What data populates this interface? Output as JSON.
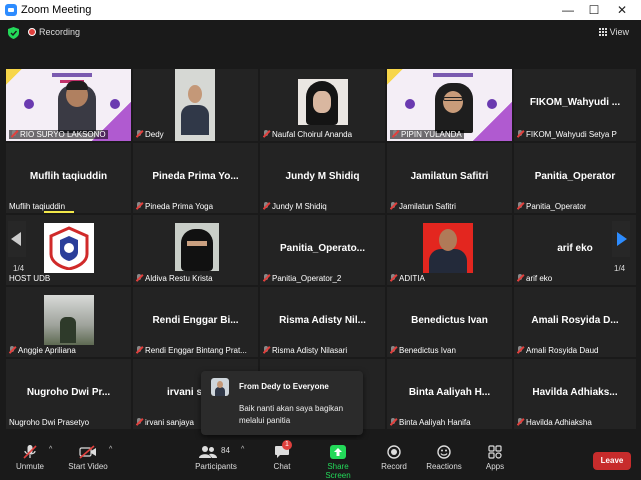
{
  "window": {
    "title": "Zoom Meeting",
    "minimize": "—",
    "maximize": "☐",
    "close": "✕"
  },
  "topbar": {
    "recording": "Recording",
    "view": "View"
  },
  "pager": {
    "left": "1/4",
    "right": "1/4"
  },
  "tiles": [
    {
      "big": "",
      "label": "RIO SURYO LAKSONO"
    },
    {
      "big": "",
      "label": "Dedy"
    },
    {
      "big": "",
      "label": "Naufal Choirul Ananda"
    },
    {
      "big": "",
      "label": "PIPIN YULANDA"
    },
    {
      "big": "FIKOM_Wahyudi ...",
      "label": "FIKOM_Wahyudi Setya P"
    },
    {
      "big": "Muflih taqiuddin",
      "label": "Muflih taqiuddin"
    },
    {
      "big": "Pineda Prima Yo...",
      "label": "Pineda Prima Yoga"
    },
    {
      "big": "Jundy M Shidiq",
      "label": "Jundy M Shidiq"
    },
    {
      "big": "Jamilatun Safitri",
      "label": "Jamilatun Safitri"
    },
    {
      "big": "Panitia_Operator",
      "label": "Panitia_Operator"
    },
    {
      "big": "",
      "label": "HOST UDB"
    },
    {
      "big": "",
      "label": "Aldiva Restu Krista"
    },
    {
      "big": "Panitia_Operato...",
      "label": "Panitia_Operator_2"
    },
    {
      "big": "",
      "label": "ADITIA"
    },
    {
      "big": "arif eko",
      "label": "arif eko"
    },
    {
      "big": "",
      "label": "Anggie Apriliana"
    },
    {
      "big": "Rendi Enggar Bi...",
      "label": "Rendi Enggar Bintang Prat..."
    },
    {
      "big": "Risma Adisty Nil...",
      "label": "Risma Adisty Nilasari"
    },
    {
      "big": "Benedictus Ivan",
      "label": "Benedictus Ivan"
    },
    {
      "big": "Amali Rosyida D...",
      "label": "Amali Rosyida Daud"
    },
    {
      "big": "Nugroho Dwi Pr...",
      "label": "Nugroho Dwi Prasetyo"
    },
    {
      "big": "irvani sa",
      "label": "irvani sanjaya"
    },
    {
      "big": "",
      "label": ""
    },
    {
      "big": "Binta Aaliyah H...",
      "label": "Binta Aaliyah Hanifa"
    },
    {
      "big": "Havilda Adhiaks...",
      "label": "Havilda Adhiaksha"
    }
  ],
  "chat_popup": {
    "from": "From Dedy to Everyone",
    "message": "Baik nanti akan saya bagikan melalui panitia"
  },
  "toolbar": {
    "unmute": "Unmute",
    "start_video": "Start Video",
    "participants": "Participants",
    "participants_count": "84",
    "chat": "Chat",
    "chat_badge": "1",
    "share_screen": "Share Screen",
    "record": "Record",
    "reactions": "Reactions",
    "apps": "Apps",
    "leave": "Leave"
  },
  "colors": {
    "accent_green": "#23d959",
    "leave_red": "#c72c2c",
    "speaker_yellow": "#f2e84a",
    "zoom_blue": "#2D8CFF"
  }
}
